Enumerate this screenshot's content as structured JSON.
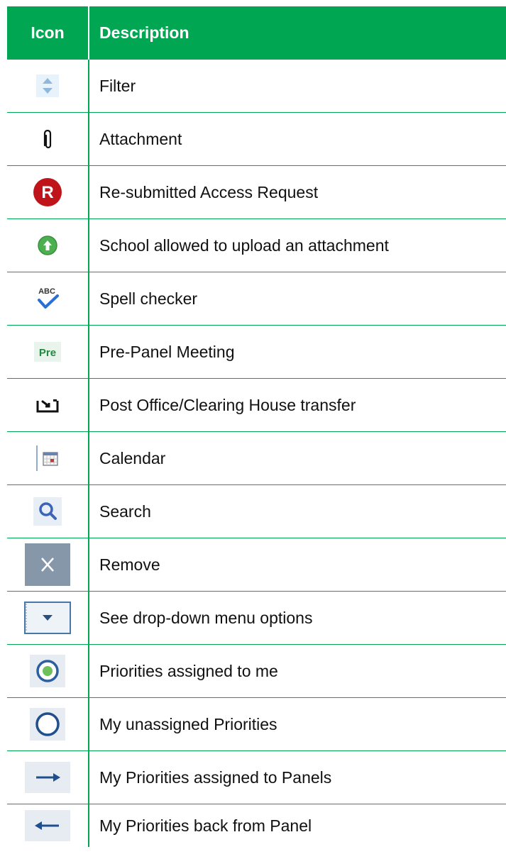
{
  "header": {
    "icon_label": "Icon",
    "description_label": "Description"
  },
  "colors": {
    "accent_green": "#00a651",
    "resubmitted_red": "#c0141b",
    "upload_green": "#4caf50"
  },
  "rows": [
    {
      "icon": "filter-icon",
      "description": "Filter"
    },
    {
      "icon": "paperclip-icon",
      "description": "Attachment"
    },
    {
      "icon": "resubmitted-r-icon",
      "icon_text": "R",
      "description": "Re-submitted Access Request"
    },
    {
      "icon": "upload-icon",
      "description": "School allowed to upload an attachment"
    },
    {
      "icon": "spell-check-icon",
      "icon_text": "ABC",
      "description": "Spell checker"
    },
    {
      "icon": "pre-panel-icon",
      "icon_text": "Pre",
      "description": "Pre-Panel Meeting"
    },
    {
      "icon": "transfer-icon",
      "description": "Post Office/Clearing House transfer"
    },
    {
      "icon": "calendar-icon",
      "description": "Calendar"
    },
    {
      "icon": "search-icon",
      "description": "Search"
    },
    {
      "icon": "remove-icon",
      "description": "Remove"
    },
    {
      "icon": "dropdown-icon",
      "description": "See drop-down menu options"
    },
    {
      "icon": "assigned-priority-icon",
      "description": "Priorities assigned to me"
    },
    {
      "icon": "unassigned-priority-icon",
      "description": "My unassigned Priorities"
    },
    {
      "icon": "arrow-right-icon",
      "description": "My Priorities assigned to Panels"
    },
    {
      "icon": "arrow-left-icon",
      "description": "My Priorities back from Panel"
    }
  ]
}
